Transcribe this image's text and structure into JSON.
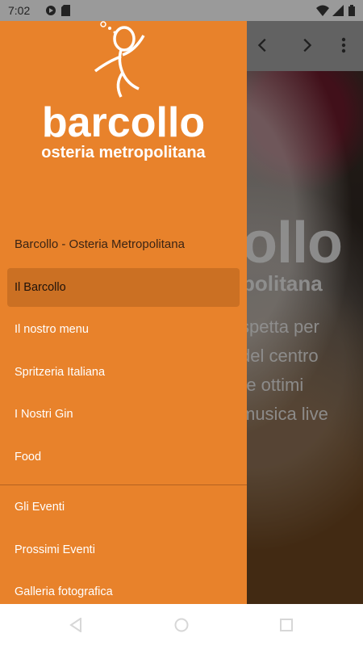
{
  "status_bar": {
    "time": "7:02"
  },
  "brand": {
    "name": "barcollo",
    "tagline": "osteria metropolitana"
  },
  "drawer": {
    "header": "Barcollo - Osteria Metropolitana",
    "items": [
      {
        "label": "Il Barcollo",
        "active": true
      },
      {
        "label": "Il nostro menu"
      },
      {
        "label": "Spritzeria Italiana"
      },
      {
        "label": "I Nostri Gin"
      },
      {
        "label": "Food"
      },
      {
        "label": "Gli Eventi"
      },
      {
        "label": "Prossimi Eventi"
      },
      {
        "label": "Galleria fotografica"
      }
    ]
  },
  "background": {
    "hero_title": "ollo",
    "hero_sub": "politana",
    "lines": [
      "spetta per",
      "del centro",
      "re ottimi",
      "musica live"
    ]
  },
  "colors": {
    "drawer": "#E8822B",
    "toolbar": "#9e9e9e"
  },
  "icons": [
    "back-arrow-icon",
    "forward-arrow-icon",
    "overflow-menu-icon",
    "wifi-icon",
    "battery-icon"
  ]
}
